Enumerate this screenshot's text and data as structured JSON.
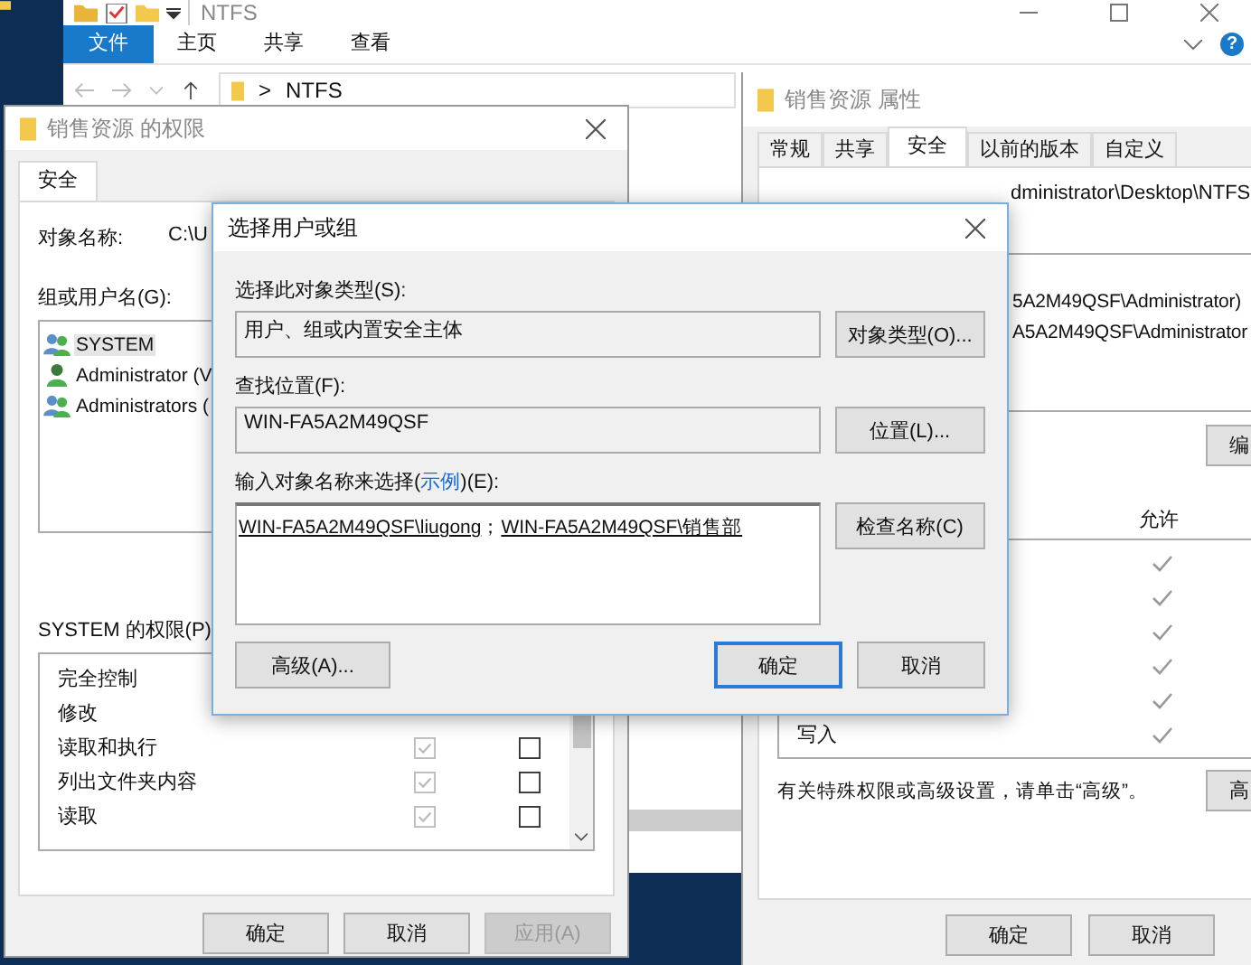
{
  "explorer": {
    "title": "NTFS",
    "ribbon_tabs": [
      {
        "label": "文件",
        "selected": true
      },
      {
        "label": "主页",
        "selected": false
      },
      {
        "label": "共享",
        "selected": false
      },
      {
        "label": "查看",
        "selected": false
      }
    ],
    "help": "?",
    "address": {
      "separator": ">",
      "path": "NTFS"
    }
  },
  "permissions_window": {
    "title": "销售资源 的权限",
    "tabs": [
      {
        "label": "安全",
        "selected": true
      }
    ],
    "object_label": "对象名称:",
    "object_value": "C:\\U",
    "groups_label": "组或用户名(G):",
    "groups": [
      {
        "name": "SYSTEM",
        "kind": "group",
        "selected": true
      },
      {
        "name": "Administrator (V",
        "kind": "user",
        "selected": false
      },
      {
        "name": "Administrators (",
        "kind": "group",
        "selected": false
      }
    ],
    "permissions_label": "SYSTEM 的权限(P)",
    "permissions": [
      {
        "name": "完全控制"
      },
      {
        "name": "修改"
      },
      {
        "name": "读取和执行",
        "allow": {
          "checked": true,
          "disabled": true
        },
        "deny": {
          "checked": false,
          "disabled": false
        }
      },
      {
        "name": "列出文件夹内容",
        "allow": {
          "checked": true,
          "disabled": true
        },
        "deny": {
          "checked": false,
          "disabled": false
        }
      },
      {
        "name": "读取",
        "allow": {
          "checked": true,
          "disabled": true
        },
        "deny": {
          "checked": false,
          "disabled": false
        }
      }
    ],
    "buttons": [
      {
        "label": "确定",
        "disabled": false
      },
      {
        "label": "取消",
        "disabled": false
      },
      {
        "label": "应用(A)",
        "disabled": true
      }
    ]
  },
  "properties_window": {
    "title": "销售资源 属性",
    "tabs": [
      {
        "label": "常规",
        "selected": false
      },
      {
        "label": "共享",
        "selected": false
      },
      {
        "label": "安全",
        "selected": true
      },
      {
        "label": "以前的版本",
        "selected": false
      },
      {
        "label": "自定义",
        "selected": false
      }
    ],
    "object_path": "dministrator\\Desktop\\NTFS",
    "groups": [
      "5A2M49QSF\\Administrator)",
      "A5A2M49QSF\\Administrator"
    ],
    "edit_button": "编",
    "allow_header": "允许",
    "permissions": [
      {
        "allow": true
      },
      {
        "allow": true
      },
      {
        "allow": true
      },
      {
        "allow": true
      },
      {
        "allow": true
      },
      {
        "name": "写入",
        "allow": true
      }
    ],
    "note": "有关特殊权限或高级设置，请单击“高级”。",
    "advanced_button": "高",
    "buttons": [
      "确定",
      "取消"
    ]
  },
  "dialog": {
    "title": "选择用户或组",
    "object_type_label": "选择此对象类型(S):",
    "object_type_value": "用户、组或内置安全主体",
    "object_type_button": "对象类型(O)...",
    "location_label": "查找位置(F):",
    "location_value": "WIN-FA5A2M49QSF",
    "location_button": "位置(L)...",
    "names_label_before": "输入对象名称来选择(",
    "names_label_link": "示例",
    "names_label_after": ")(E):",
    "names": [
      "WIN-FA5A2M49QSF\\liugong",
      "WIN-FA5A2M49QSF\\销售部"
    ],
    "names_separator": "；",
    "check_button": "检查名称(C)",
    "advanced_button": "高级(A)...",
    "buttons": [
      {
        "label": "确定",
        "default": true
      },
      {
        "label": "取消",
        "default": false
      }
    ]
  }
}
